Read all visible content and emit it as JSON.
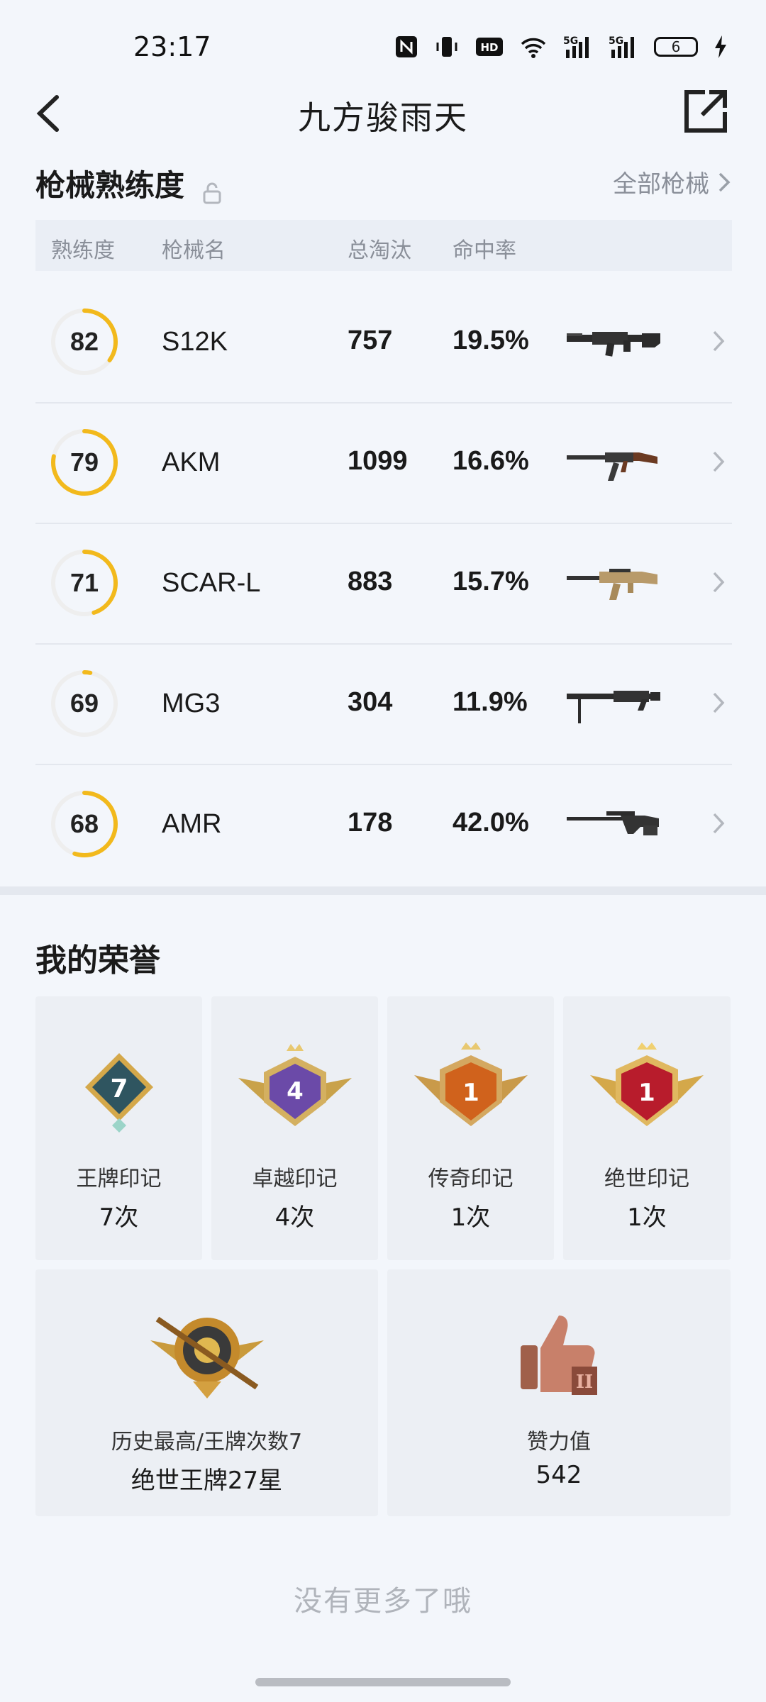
{
  "status": {
    "time": "23:17",
    "battery": "6",
    "signal_label": "5G"
  },
  "header": {
    "title": "九方骏雨天"
  },
  "mastery": {
    "section_title": "枪械熟练度",
    "all_link": "全部枪械",
    "columns": [
      "熟练度",
      "枪械名",
      "总淘汰",
      "命中率"
    ],
    "guns": [
      {
        "level": "82",
        "progress": 0.35,
        "name": "S12K",
        "kills": "757",
        "hit_rate": "19.5%"
      },
      {
        "level": "79",
        "progress": 0.78,
        "name": "AKM",
        "kills": "1099",
        "hit_rate": "16.6%"
      },
      {
        "level": "71",
        "progress": 0.45,
        "name": "SCAR-L",
        "kills": "883",
        "hit_rate": "15.7%"
      },
      {
        "level": "69",
        "progress": 0.03,
        "name": "MG3",
        "kills": "304",
        "hit_rate": "11.9%"
      },
      {
        "level": "68",
        "progress": 0.55,
        "name": "AMR",
        "kills": "178",
        "hit_rate": "42.0%"
      }
    ]
  },
  "honors": {
    "section_title": "我的荣誉",
    "marks": [
      {
        "badge_num": "7",
        "label": "王牌印记",
        "value": "7次"
      },
      {
        "badge_num": "4",
        "label": "卓越印记",
        "value": "4次"
      },
      {
        "badge_num": "1",
        "label": "传奇印记",
        "value": "1次"
      },
      {
        "badge_num": "1",
        "label": "绝世印记",
        "value": "1次"
      }
    ],
    "history": {
      "label": "历史最高/王牌次数7",
      "value": "绝世王牌27星"
    },
    "likes": {
      "label": "赞力值",
      "value": "542"
    }
  },
  "footer": {
    "text": "没有更多了哦"
  },
  "colors": {
    "ring_track": "#eeeeee",
    "ring_fill": "#f2b91c",
    "background": "#f3f6fb"
  }
}
